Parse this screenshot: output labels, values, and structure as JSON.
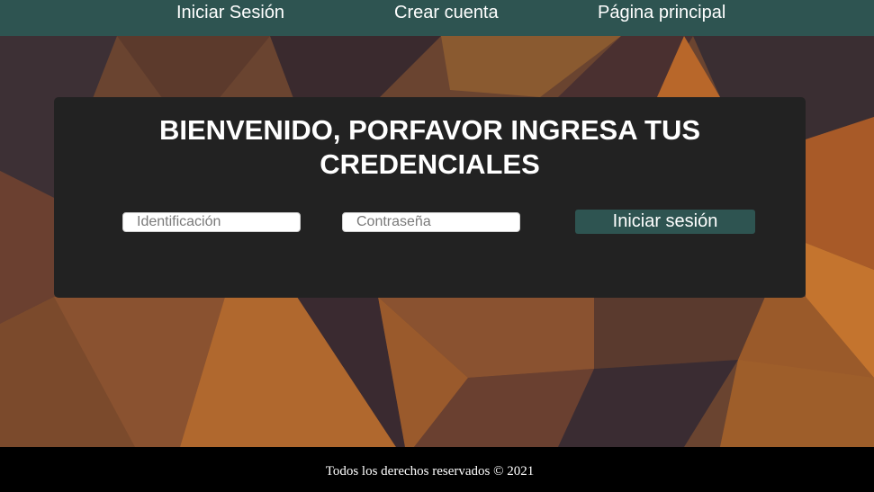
{
  "nav": {
    "items": [
      {
        "label": "Iniciar Sesión"
      },
      {
        "label": "Crear cuenta"
      },
      {
        "label": "Página principal"
      }
    ]
  },
  "login": {
    "title_line1": "BIENVENIDO, PORFAVOR INGRESA TUS",
    "title_line2": "CREDENCIALES",
    "id_placeholder": "Identificación",
    "id_value": "",
    "password_placeholder": "Contraseña",
    "password_value": "",
    "submit_label": "Iniciar sesión"
  },
  "footer": {
    "text": "Todos los derechos reservados © 2021"
  },
  "colors": {
    "nav_bg": "#2e5451",
    "card_bg": "#222222",
    "button_bg": "#2e5451",
    "footer_bg": "#000000",
    "text": "#ffffff"
  }
}
